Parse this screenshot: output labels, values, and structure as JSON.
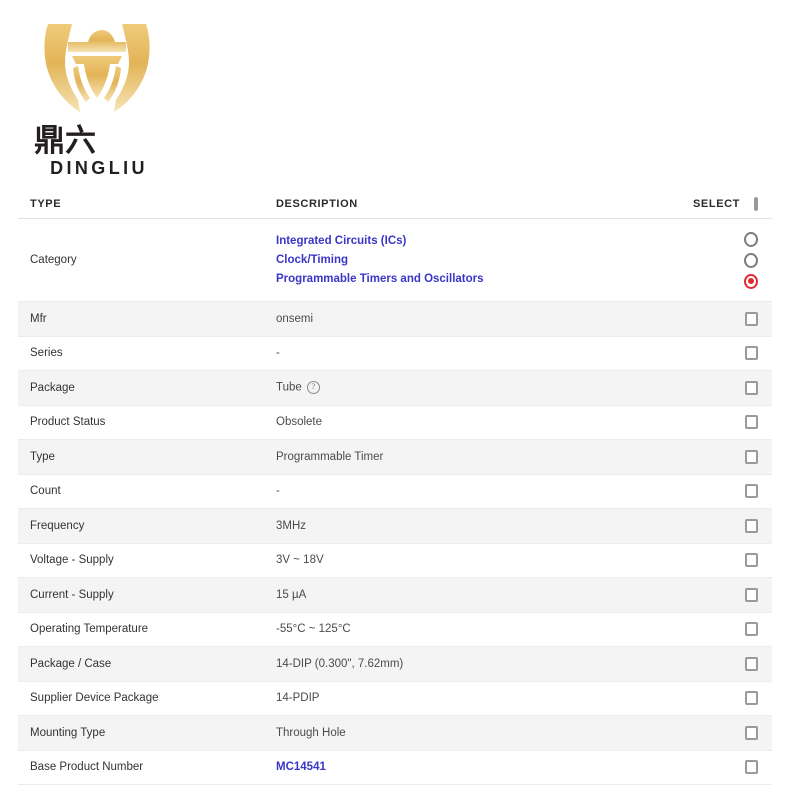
{
  "logo": {
    "brand_latin": "DINGLIU",
    "brand_cn": "鼎六",
    "mark_color": "#e8b95c",
    "wordmark_color": "#231f20"
  },
  "table": {
    "headers": {
      "type": "TYPE",
      "description": "DESCRIPTION",
      "select": "SELECT",
      "select_all_icon": "checkbox-icon"
    },
    "category_row": {
      "label": "Category",
      "links": [
        "Integrated Circuits (ICs)",
        "Clock/Timing",
        "Programmable Timers and Oscillators"
      ],
      "radios": [
        {
          "selected": false
        },
        {
          "selected": false
        },
        {
          "selected": true
        }
      ],
      "link_color": "#3a36c8",
      "selected_radio_color": "#e02a2f"
    },
    "rows": [
      {
        "label": "Mfr",
        "value": "onsemi",
        "shaded": true,
        "checked": false
      },
      {
        "label": "Series",
        "value": "-",
        "shaded": false,
        "checked": false
      },
      {
        "label": "Package",
        "value": "Tube",
        "help_icon": "question-mark-icon",
        "shaded": true,
        "checked": false
      },
      {
        "label": "Product Status",
        "value": "Obsolete",
        "shaded": false,
        "checked": false
      },
      {
        "label": "Type",
        "value": "Programmable Timer",
        "shaded": true,
        "checked": false
      },
      {
        "label": "Count",
        "value": "-",
        "shaded": false,
        "checked": false
      },
      {
        "label": "Frequency",
        "value": "3MHz",
        "shaded": true,
        "checked": false
      },
      {
        "label": "Voltage - Supply",
        "value": "3V ~ 18V",
        "shaded": false,
        "checked": false
      },
      {
        "label": "Current - Supply",
        "value": "15 µA",
        "shaded": true,
        "checked": false
      },
      {
        "label": "Operating Temperature",
        "value": "-55°C ~ 125°C",
        "shaded": false,
        "checked": false
      },
      {
        "label": "Package / Case",
        "value": "14-DIP (0.300\", 7.62mm)",
        "shaded": true,
        "checked": false
      },
      {
        "label": "Supplier Device Package",
        "value": "14-PDIP",
        "shaded": false,
        "checked": false
      },
      {
        "label": "Mounting Type",
        "value": "Through Hole",
        "shaded": true,
        "checked": false
      },
      {
        "label": "Base Product Number",
        "value": "MC14541",
        "is_link": true,
        "shaded": false,
        "checked": false
      }
    ]
  }
}
